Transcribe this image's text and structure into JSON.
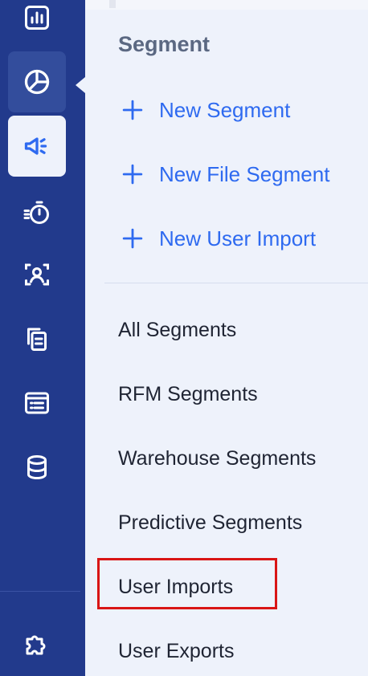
{
  "colors": {
    "rail_bg": "#223a8c",
    "panel_bg": "#eef2fb",
    "accent": "#2e6af0",
    "text": "#1f2433",
    "title": "#5b6882",
    "highlight": "#d91515"
  },
  "rail": {
    "items": [
      {
        "icon": "bar-chart-icon",
        "state": "default"
      },
      {
        "icon": "pie-chart-icon",
        "state": "hover"
      },
      {
        "icon": "megaphone-icon",
        "state": "active"
      },
      {
        "icon": "stopwatch-icon",
        "state": "default"
      },
      {
        "icon": "user-frame-icon",
        "state": "default"
      },
      {
        "icon": "documents-icon",
        "state": "default"
      },
      {
        "icon": "list-table-icon",
        "state": "default"
      },
      {
        "icon": "database-icon",
        "state": "default"
      },
      {
        "icon": "puzzle-icon",
        "state": "default"
      }
    ]
  },
  "panel": {
    "title": "Segment",
    "actions": [
      {
        "label": "New Segment",
        "icon": "plus-icon"
      },
      {
        "label": "New File Segment",
        "icon": "plus-icon"
      },
      {
        "label": "New User Import",
        "icon": "plus-icon"
      }
    ],
    "links": [
      {
        "label": "All Segments"
      },
      {
        "label": "RFM Segments"
      },
      {
        "label": "Warehouse Segments"
      },
      {
        "label": "Predictive Segments"
      },
      {
        "label": "User Imports",
        "highlighted": true
      },
      {
        "label": "User Exports"
      }
    ]
  }
}
